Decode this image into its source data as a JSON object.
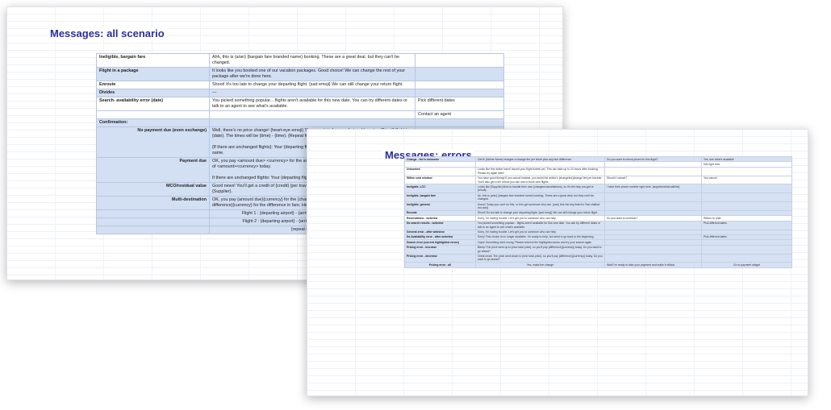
{
  "sheet_all": {
    "title": "Messages: all scenario",
    "rows": {
      "ineligible_label": "Ineligible, bargain fare",
      "ineligible_msg": "Ahh, this is (a/an) {bargain fare branded name} booking. These are a great deal, but they can't be changed.",
      "package_label": "Flight in a package",
      "package_msg": "It looks like you booked one of our vacation packages. Good choice! We can change the rest of your package after we're done here.",
      "enroute_label": "Enroute",
      "enroute_msg": "Shoot! It's too late to change your departing flight. {sad emoji} We can still change your return flight.",
      "divides_label": "Divides",
      "divides_msg": "—",
      "search_label": "Search- availability error (date)",
      "search_msg": "You picked something popular... flights aren't available for this new date. You can try different dates or talk to an agent to see what's available.",
      "search_action_1": "Pick different dates",
      "search_action_2": "Contact an agent",
      "confirmation_label": "Confirmation:",
      "nopay_label": "No payment due (even exchange)",
      "nopay_msg": "Well, there's no price change! {heart-eye emoji} The new date for your {return/departure/Trip #} flight is {date}. The times will be {time} - {time}. {Repeat for other changed flights}",
      "nopay_msg2": "{If there are unchanged flights}: Your {departing flight/returning flight/remaining flights} will remain the same.",
      "paydue_label": "Payment due",
      "paydue_msg": "OK, you pay <amount due> <currency> for the airline change fee {if change fee >0} and fare difference of <amount><currency> today.",
      "paydue_msg2": "If there are unchanged flights: Your {departing flight/returning flight/remaining flights} will remain the",
      "mco_label": "MCO/residual value",
      "mco_msg": "Good news! You'll get a credit of {credit} (per traveler) to use on {Brand} later for a booking with {Supplier}.",
      "multi_label": "Multi-destination",
      "multi_msg": "OK, you pay {amount due}{currency} for the {change fee}{currency} airline change fee and {fare difference}{currency} for the difference in fare. Here's how it breaks down:",
      "flight1": "Flight 1 : {departing airport} - {arriving airport} : {fare difference}{currency}",
      "flight2": "Flight 2 : {departing airport} - {arriving airport}: {fare difference}{currency}",
      "repeat": "{repeat up to 5 flights}"
    }
  },
  "sheet_errors": {
    "title": "Messages: errors",
    "rows": [
      {
        "label": "Change - fee is unknown",
        "msg": "Get it! (Airline Name) charges a change fee per ticket plus any fare difference.",
        "extra": "Do you want to check prices for this flight?",
        "action": "Yes, see what's available",
        "hl": true
      },
      {
        "label": "",
        "msg": "",
        "extra": "",
        "action": "Not right now",
        "hl": false
      },
      {
        "label": "Unbooked",
        "msg": "Looks like this airline hasn't issued your flight tickets yet. This can take up to 24 hours after booking. Please try again later!",
        "extra": "",
        "action": "",
        "hl": false
      },
      {
        "label": "Within void window",
        "msg": "You have good timing! If you cancel instead, you avoid the airline's {changefee}change fee per traveler. You'll also get a full refund you can use to book new flights.",
        "extra": "Should I cancel?",
        "action": "You cancel",
        "hl": false
      },
      {
        "label": "Ineligible, LCC",
        "msg": "Looks like {Supplier} likes to handle their own {changes/cancellations}, so it's the help you get is {result}.",
        "extra": "I have their phone number right here. {supplier/click/call/link}",
        "action": "",
        "hl": true
      },
      {
        "label": "Ineligible, bargain fare",
        "msg": "Ah, this is {a/an} {bargain fare branded name} booking. These are a great deal, but they can't be changed.",
        "extra": "",
        "action": "",
        "hl": true
      },
      {
        "label": "Ineligible, general",
        "msg": "Sorry!! Today you can't do this, or let's get someone who can. {sad} Use the key listed in Test chatbot doc add}",
        "extra": "",
        "action": "",
        "hl": true
      },
      {
        "label": "Enroute",
        "msg": "Shoot! It's too late to change your departing flight. {sad emoji} We can still change your return flight.",
        "extra": "",
        "action": "",
        "hl": true
      },
      {
        "label": "Reservations - webview",
        "msg": "Sorry, I'm having trouble. Let's get you to someone who can help.",
        "extra": "Do you want to continue?",
        "action": "Return to chat",
        "hl": false
      },
      {
        "label": "No search results - webview",
        "msg": "You picked something popular... flights aren't available for this new date. You can try different dates or talk to an agent to see what's available.",
        "extra": "",
        "action": "Pick different dates",
        "hl": true
      },
      {
        "label": "General error - after webview",
        "msg": "Sorry, I'm having trouble. Let's get you to someone who can help.",
        "extra": "",
        "action": "",
        "hl": true
      },
      {
        "label": "No Availability error - after webview",
        "msg": "Sorry! This choice is no longer available. I'm ready to help, but need to go back to the beginning.",
        "extra": "",
        "action": "Pick different dates",
        "hl": true
      },
      {
        "label": "Search error (current highlighted errors)",
        "msg": "Oops! Something went wrong. Please recheck the highlighted areas and try your search again.",
        "extra": "",
        "action": "",
        "hl": true
      },
      {
        "label": "Pricing error - increase",
        "msg": "Bleep! The price went up to {new total price}, so you'll pay {difference}{currency} today. Do you want to go ahead?",
        "extra": "",
        "action": "",
        "hl": true
      },
      {
        "label": "Pricing error - decrease",
        "msg": "Great news! The price went down to {new total price}, so you'll pay {difference}{currency} today. Do you want to go ahead?",
        "extra": "",
        "action": "",
        "hl": true
      }
    ],
    "footer": {
      "label": "Pricing error - all",
      "col1": "Yes, make the change",
      "col2": "Wait! I'm ready to take your payment and make it official.",
      "col3": "Go to payment widget"
    }
  }
}
